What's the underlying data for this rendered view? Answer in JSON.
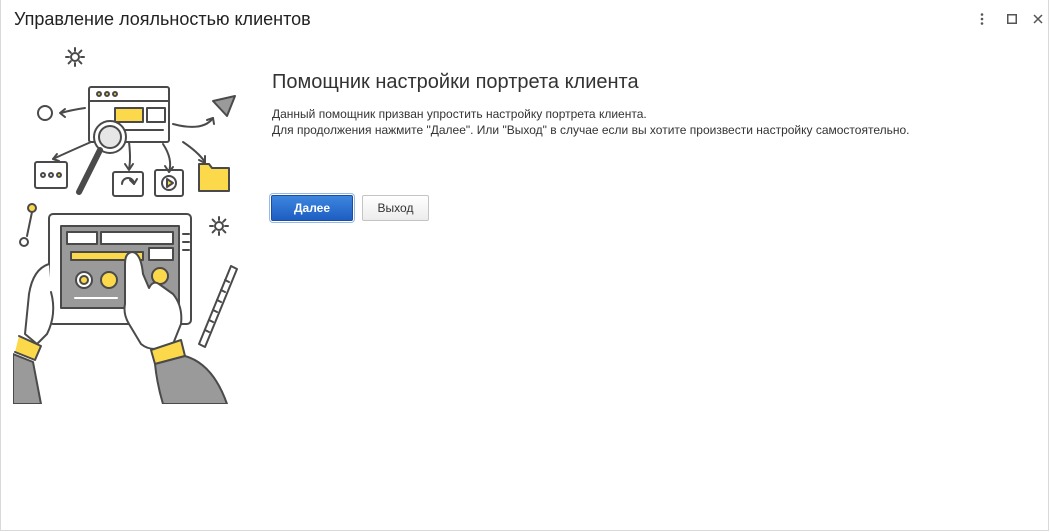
{
  "window": {
    "title": "Управление лояльностью клиентов",
    "controls": {
      "more_icon": "more-vertical-icon",
      "maximize_icon": "maximize-icon",
      "close_icon": "close-icon"
    }
  },
  "wizard": {
    "heading": "Помощник настройки портрета клиента",
    "description_lines": [
      "Данный помощник призван упростить настройку портрета клиента.",
      "Для продолжения нажмите \"Далее\". Или \"Выход\" в случае если вы хотите произвести настройку самостоятельно."
    ],
    "buttons": {
      "next_label": "Далее",
      "exit_label": "Выход"
    }
  },
  "colors": {
    "accent": "#2a6fd6",
    "illustration_yellow": "#fbd94a",
    "illustration_gray": "#9a9a9a",
    "illustration_stroke": "#4a4a4a"
  }
}
